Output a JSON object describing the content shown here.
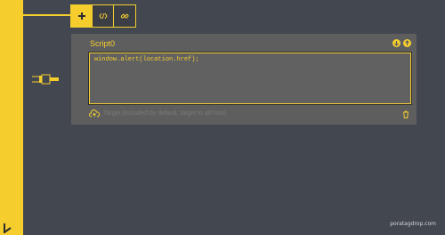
{
  "script": {
    "title": "Script0",
    "code": "window.alert(location.href);",
    "target_placeholder": "Target (Included by default, target to all host)"
  },
  "toolbar": {
    "buttons": [
      "add-icon",
      "code-icon",
      "link-icon"
    ]
  },
  "watermark": "poratagdrop.com",
  "colors": {
    "accent": "#f5ce2e",
    "background": "#434750",
    "panel": "#5e5e5f"
  }
}
